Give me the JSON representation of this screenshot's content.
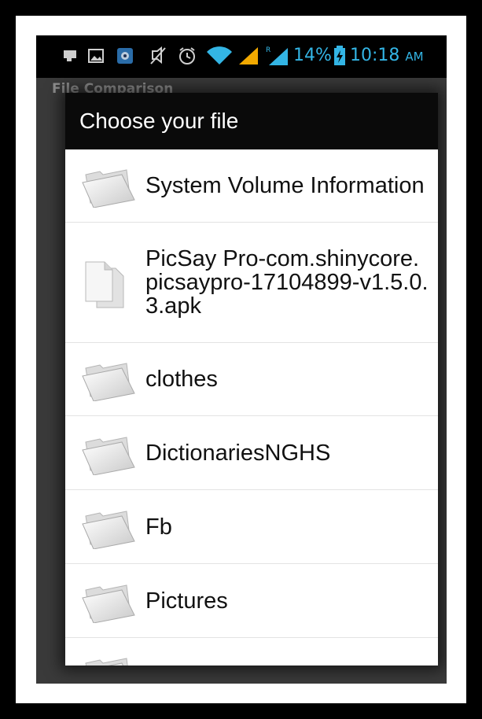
{
  "status_bar": {
    "battery_percent": "14%",
    "time": "10:18",
    "ampm": "AM",
    "icons": [
      "notification-icon",
      "image-icon",
      "app-icon",
      "mute-icon",
      "alarm-icon",
      "wifi-icon",
      "signal-icon",
      "roaming-signal-icon",
      "battery-charging-icon"
    ],
    "accent_color": "#33b5e5"
  },
  "app": {
    "title": "File Comparison"
  },
  "dialog": {
    "title": "Choose your file",
    "items": [
      {
        "label": "System Volume Information",
        "icon": "folder-icon"
      },
      {
        "label": "PicSay Pro-com.shinycore.picsaypro-17104899-v1.5.0.3.apk",
        "icon": "file-icon"
      },
      {
        "label": "clothes",
        "icon": "folder-icon"
      },
      {
        "label": "DictionariesNGHS",
        "icon": "folder-icon"
      },
      {
        "label": "Fb",
        "icon": "folder-icon"
      },
      {
        "label": "Pictures",
        "icon": "folder-icon"
      },
      {
        "label": "",
        "icon": "folder-icon"
      }
    ]
  }
}
